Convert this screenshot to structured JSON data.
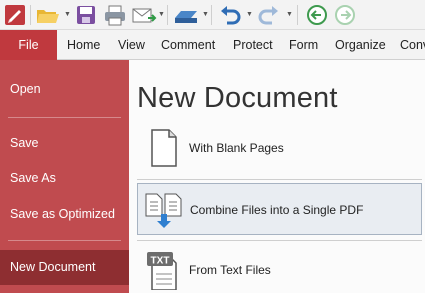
{
  "toolbar": {
    "items": [
      "app-logo",
      "open-folder",
      "save",
      "print",
      "email",
      "scan",
      "undo",
      "redo",
      "back",
      "forward"
    ]
  },
  "ribbon": {
    "tabs": [
      "File",
      "Home",
      "View",
      "Comment",
      "Protect",
      "Form",
      "Organize",
      "Conv"
    ]
  },
  "sidebar": {
    "items": [
      "Open",
      "Save",
      "Save As",
      "Save as Optimized",
      "New Document"
    ]
  },
  "main": {
    "title": "New Document",
    "options": [
      "With Blank Pages",
      "Combine Files into a Single PDF",
      "From Text Files"
    ]
  },
  "colors": {
    "file_tab": "#c0393e",
    "sidebar": "#c04b4f",
    "sidebar_active": "#8e2e31",
    "selected_option_bg": "#e9edf2",
    "selected_option_border": "#a7b3c2"
  }
}
